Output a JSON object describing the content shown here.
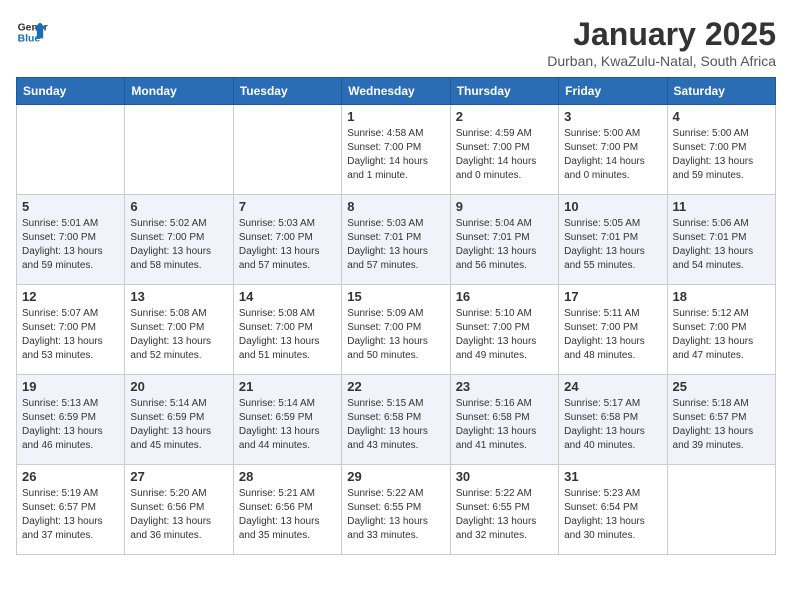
{
  "header": {
    "logo_line1": "General",
    "logo_line2": "Blue",
    "month": "January 2025",
    "location": "Durban, KwaZulu-Natal, South Africa"
  },
  "weekdays": [
    "Sunday",
    "Monday",
    "Tuesday",
    "Wednesday",
    "Thursday",
    "Friday",
    "Saturday"
  ],
  "weeks": [
    [
      {
        "day": "",
        "info": ""
      },
      {
        "day": "",
        "info": ""
      },
      {
        "day": "",
        "info": ""
      },
      {
        "day": "1",
        "info": "Sunrise: 4:58 AM\nSunset: 7:00 PM\nDaylight: 14 hours\nand 1 minute."
      },
      {
        "day": "2",
        "info": "Sunrise: 4:59 AM\nSunset: 7:00 PM\nDaylight: 14 hours\nand 0 minutes."
      },
      {
        "day": "3",
        "info": "Sunrise: 5:00 AM\nSunset: 7:00 PM\nDaylight: 14 hours\nand 0 minutes."
      },
      {
        "day": "4",
        "info": "Sunrise: 5:00 AM\nSunset: 7:00 PM\nDaylight: 13 hours\nand 59 minutes."
      }
    ],
    [
      {
        "day": "5",
        "info": "Sunrise: 5:01 AM\nSunset: 7:00 PM\nDaylight: 13 hours\nand 59 minutes."
      },
      {
        "day": "6",
        "info": "Sunrise: 5:02 AM\nSunset: 7:00 PM\nDaylight: 13 hours\nand 58 minutes."
      },
      {
        "day": "7",
        "info": "Sunrise: 5:03 AM\nSunset: 7:00 PM\nDaylight: 13 hours\nand 57 minutes."
      },
      {
        "day": "8",
        "info": "Sunrise: 5:03 AM\nSunset: 7:01 PM\nDaylight: 13 hours\nand 57 minutes."
      },
      {
        "day": "9",
        "info": "Sunrise: 5:04 AM\nSunset: 7:01 PM\nDaylight: 13 hours\nand 56 minutes."
      },
      {
        "day": "10",
        "info": "Sunrise: 5:05 AM\nSunset: 7:01 PM\nDaylight: 13 hours\nand 55 minutes."
      },
      {
        "day": "11",
        "info": "Sunrise: 5:06 AM\nSunset: 7:01 PM\nDaylight: 13 hours\nand 54 minutes."
      }
    ],
    [
      {
        "day": "12",
        "info": "Sunrise: 5:07 AM\nSunset: 7:00 PM\nDaylight: 13 hours\nand 53 minutes."
      },
      {
        "day": "13",
        "info": "Sunrise: 5:08 AM\nSunset: 7:00 PM\nDaylight: 13 hours\nand 52 minutes."
      },
      {
        "day": "14",
        "info": "Sunrise: 5:08 AM\nSunset: 7:00 PM\nDaylight: 13 hours\nand 51 minutes."
      },
      {
        "day": "15",
        "info": "Sunrise: 5:09 AM\nSunset: 7:00 PM\nDaylight: 13 hours\nand 50 minutes."
      },
      {
        "day": "16",
        "info": "Sunrise: 5:10 AM\nSunset: 7:00 PM\nDaylight: 13 hours\nand 49 minutes."
      },
      {
        "day": "17",
        "info": "Sunrise: 5:11 AM\nSunset: 7:00 PM\nDaylight: 13 hours\nand 48 minutes."
      },
      {
        "day": "18",
        "info": "Sunrise: 5:12 AM\nSunset: 7:00 PM\nDaylight: 13 hours\nand 47 minutes."
      }
    ],
    [
      {
        "day": "19",
        "info": "Sunrise: 5:13 AM\nSunset: 6:59 PM\nDaylight: 13 hours\nand 46 minutes."
      },
      {
        "day": "20",
        "info": "Sunrise: 5:14 AM\nSunset: 6:59 PM\nDaylight: 13 hours\nand 45 minutes."
      },
      {
        "day": "21",
        "info": "Sunrise: 5:14 AM\nSunset: 6:59 PM\nDaylight: 13 hours\nand 44 minutes."
      },
      {
        "day": "22",
        "info": "Sunrise: 5:15 AM\nSunset: 6:58 PM\nDaylight: 13 hours\nand 43 minutes."
      },
      {
        "day": "23",
        "info": "Sunrise: 5:16 AM\nSunset: 6:58 PM\nDaylight: 13 hours\nand 41 minutes."
      },
      {
        "day": "24",
        "info": "Sunrise: 5:17 AM\nSunset: 6:58 PM\nDaylight: 13 hours\nand 40 minutes."
      },
      {
        "day": "25",
        "info": "Sunrise: 5:18 AM\nSunset: 6:57 PM\nDaylight: 13 hours\nand 39 minutes."
      }
    ],
    [
      {
        "day": "26",
        "info": "Sunrise: 5:19 AM\nSunset: 6:57 PM\nDaylight: 13 hours\nand 37 minutes."
      },
      {
        "day": "27",
        "info": "Sunrise: 5:20 AM\nSunset: 6:56 PM\nDaylight: 13 hours\nand 36 minutes."
      },
      {
        "day": "28",
        "info": "Sunrise: 5:21 AM\nSunset: 6:56 PM\nDaylight: 13 hours\nand 35 minutes."
      },
      {
        "day": "29",
        "info": "Sunrise: 5:22 AM\nSunset: 6:55 PM\nDaylight: 13 hours\nand 33 minutes."
      },
      {
        "day": "30",
        "info": "Sunrise: 5:22 AM\nSunset: 6:55 PM\nDaylight: 13 hours\nand 32 minutes."
      },
      {
        "day": "31",
        "info": "Sunrise: 5:23 AM\nSunset: 6:54 PM\nDaylight: 13 hours\nand 30 minutes."
      },
      {
        "day": "",
        "info": ""
      }
    ]
  ]
}
